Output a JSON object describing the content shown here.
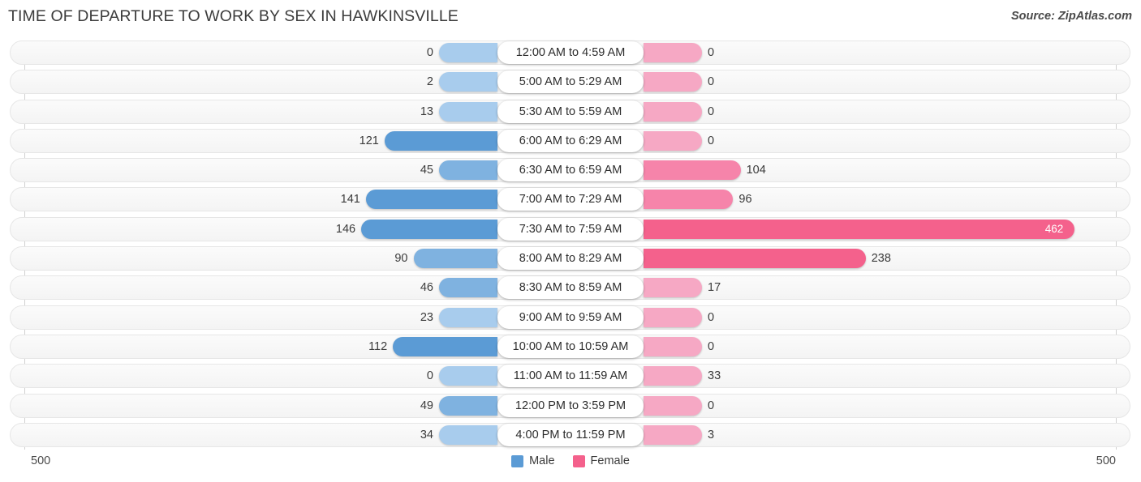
{
  "header": {
    "title": "TIME OF DEPARTURE TO WORK BY SEX IN HAWKINSVILLE",
    "source": "Source: ZipAtlas.com"
  },
  "axis": {
    "left_tick": "500",
    "right_tick": "500"
  },
  "legend": {
    "items": [
      {
        "label": "Male",
        "color": "#5b9bd5"
      },
      {
        "label": "Female",
        "color": "#f4618c"
      }
    ]
  },
  "colors": {
    "male_dark": "#5b9bd5",
    "male_light": "#a8cced",
    "female_dark": "#f4618c",
    "female_light": "#f6a8c4",
    "track_bg": "#f6f6f6",
    "track_border": "#e6e6e6",
    "axis_line": "#d0d0d0"
  },
  "chart_data": {
    "type": "bar",
    "title": "TIME OF DEPARTURE TO WORK BY SEX IN HAWKINSVILLE",
    "subtitle": "",
    "xlabel": "",
    "ylabel": "",
    "orientation": "horizontal-diverging",
    "axis_max": 500,
    "xlim": [
      500,
      500
    ],
    "grid": false,
    "legend_position": "bottom-center",
    "categories": [
      "12:00 AM to 4:59 AM",
      "5:00 AM to 5:29 AM",
      "5:30 AM to 5:59 AM",
      "6:00 AM to 6:29 AM",
      "6:30 AM to 6:59 AM",
      "7:00 AM to 7:29 AM",
      "7:30 AM to 7:59 AM",
      "8:00 AM to 8:29 AM",
      "8:30 AM to 8:59 AM",
      "9:00 AM to 9:59 AM",
      "10:00 AM to 10:59 AM",
      "11:00 AM to 11:59 AM",
      "12:00 PM to 3:59 PM",
      "4:00 PM to 11:59 PM"
    ],
    "series": [
      {
        "name": "Male",
        "side": "left",
        "values": [
          0,
          2,
          13,
          121,
          45,
          141,
          146,
          90,
          46,
          23,
          112,
          0,
          49,
          34
        ]
      },
      {
        "name": "Female",
        "side": "right",
        "values": [
          0,
          0,
          0,
          0,
          104,
          96,
          462,
          238,
          17,
          0,
          0,
          33,
          0,
          3
        ]
      }
    ]
  },
  "rows": [
    {
      "label": "12:00 AM to 4:59 AM",
      "male": "0",
      "female": "0"
    },
    {
      "label": "5:00 AM to 5:29 AM",
      "male": "2",
      "female": "0"
    },
    {
      "label": "5:30 AM to 5:59 AM",
      "male": "13",
      "female": "0"
    },
    {
      "label": "6:00 AM to 6:29 AM",
      "male": "121",
      "female": "0"
    },
    {
      "label": "6:30 AM to 6:59 AM",
      "male": "45",
      "female": "104"
    },
    {
      "label": "7:00 AM to 7:29 AM",
      "male": "141",
      "female": "96"
    },
    {
      "label": "7:30 AM to 7:59 AM",
      "male": "146",
      "female": "462"
    },
    {
      "label": "8:00 AM to 8:29 AM",
      "male": "90",
      "female": "238"
    },
    {
      "label": "8:30 AM to 8:59 AM",
      "male": "46",
      "female": "17"
    },
    {
      "label": "9:00 AM to 9:59 AM",
      "male": "23",
      "female": "0"
    },
    {
      "label": "10:00 AM to 10:59 AM",
      "male": "112",
      "female": "0"
    },
    {
      "label": "11:00 AM to 11:59 AM",
      "male": "0",
      "female": "33"
    },
    {
      "label": "12:00 PM to 3:59 PM",
      "male": "49",
      "female": "0"
    },
    {
      "label": "4:00 PM to 11:59 PM",
      "male": "34",
      "female": "3"
    }
  ]
}
